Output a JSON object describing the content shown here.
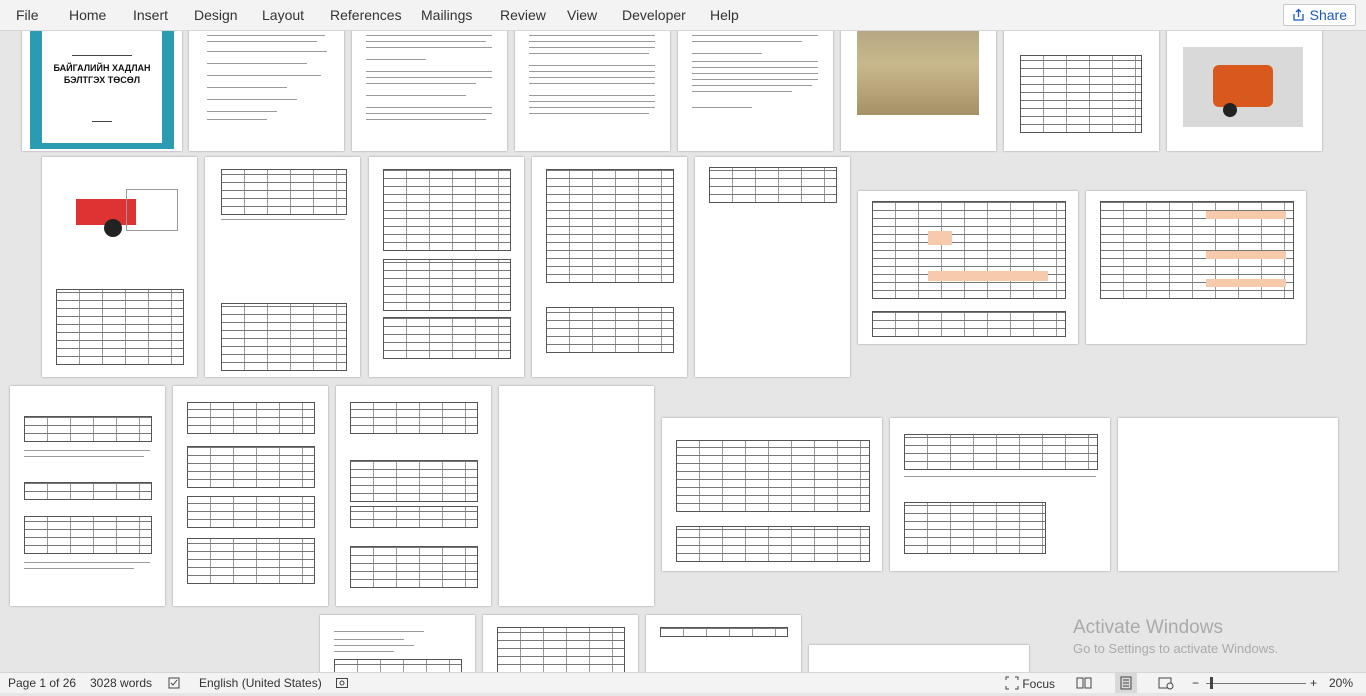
{
  "ribbon": {
    "tabs": [
      "File",
      "Home",
      "Insert",
      "Design",
      "Layout",
      "References",
      "Mailings",
      "Review",
      "View",
      "Developer",
      "Help"
    ],
    "share_label": "Share"
  },
  "document": {
    "cover_title_line1": "БАЙГАЛИЙН ХАДЛАН",
    "cover_title_line2": "БЭЛТГЭХ ТӨСӨЛ"
  },
  "status_bar": {
    "page_info": "Page 1 of 26",
    "word_count": "3028 words",
    "language": "English (United States)",
    "focus_label": "Focus",
    "zoom": "20%"
  },
  "watermark": {
    "line1": "Activate Windows",
    "line2": "Go to Settings to activate Windows."
  },
  "colors": {
    "accent": "#185abd",
    "cover_teal": "#2a9bb0",
    "machine_orange": "#d8581e",
    "highlight_cell": "#f7caac"
  }
}
